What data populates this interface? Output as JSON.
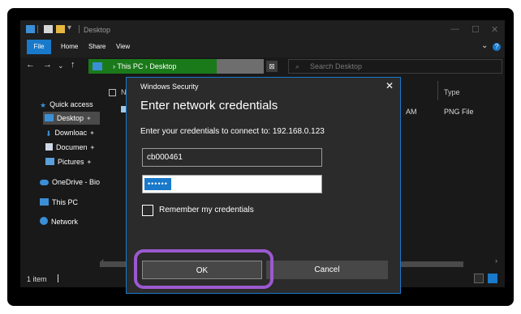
{
  "window": {
    "title": "Desktop"
  },
  "ribbon": {
    "tabs": [
      "File",
      "Home",
      "Share",
      "View"
    ]
  },
  "nav": {
    "breadcrumbs": "›  This PC  ›  Desktop",
    "search_placeholder": "Search Desktop"
  },
  "sidebar": {
    "items": [
      {
        "label": "Quick access",
        "icon": "star-icon"
      },
      {
        "label": "Desktop",
        "icon": "desktop-icon",
        "selected": true
      },
      {
        "label": "Downloac",
        "icon": "download-icon"
      },
      {
        "label": "Documen",
        "icon": "document-icon"
      },
      {
        "label": "Pictures",
        "icon": "pictures-icon"
      },
      {
        "label": "OneDrive - Bio",
        "icon": "cloud-icon"
      },
      {
        "label": "This PC",
        "icon": "pc-icon"
      },
      {
        "label": "Network",
        "icon": "network-icon"
      }
    ]
  },
  "content": {
    "col_name_initial": "N",
    "col_type": "Type",
    "row": {
      "time_suffix": "AM",
      "type": "PNG File"
    }
  },
  "status": {
    "count": "1 item"
  },
  "dialog": {
    "caption": "Windows Security",
    "title": "Enter network credentials",
    "description": "Enter your credentials to connect to: 192.168.0.123",
    "username": "cb000461",
    "password_mask": "••••••",
    "remember_label": "Remember my credentials",
    "ok_label": "OK",
    "cancel_label": "Cancel"
  },
  "colors": {
    "accent": "#1979ca",
    "address_bar": "#1a7a1a",
    "highlight": "#9b59d0"
  }
}
